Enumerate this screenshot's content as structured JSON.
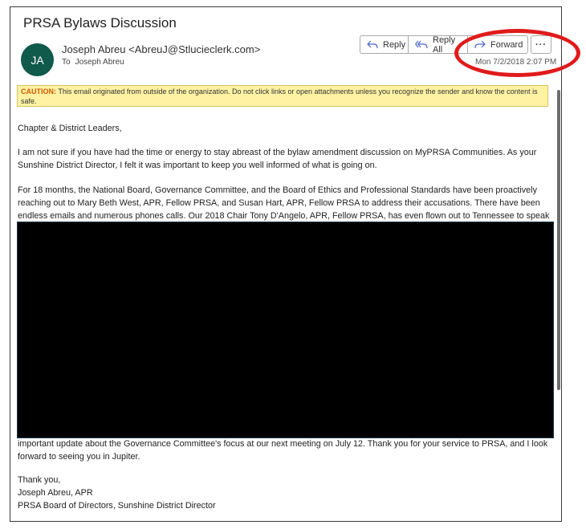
{
  "email": {
    "subject": "PRSA Bylaws Discussion",
    "avatar_initials": "JA",
    "sender": "Joseph Abreu <AbreuJ@Stlucieclerk.com>",
    "to_label": "To",
    "to_name": "Joseph Abreu",
    "date": "Mon 7/2/2018 2:07 PM"
  },
  "actions": {
    "reply": "Reply",
    "reply_all": "Reply All",
    "forward": "Forward",
    "more": "···"
  },
  "caution": {
    "label": "CAUTION:",
    "text": " This email originated from outside of the organization. Do not click links or open attachments unless you recognize the sender and know the content is safe."
  },
  "body": {
    "greeting": "Chapter & District Leaders,",
    "para1": "I am not sure if you have had the time or energy to stay abreast of the bylaw amendment discussion on MyPRSA Communities. As your Sunshine District Director, I felt it was important to keep you well informed of what is going on.",
    "para2": "For 18 months, the National Board, Governance Committee, and the Board of Ethics and Professional Standards have been proactively reaching out to Mary Beth West, APR, Fellow PRSA, and Susan Hart, APR, Fellow PRSA to address their accusations. There have been endless emails and numerous phones calls. Our 2018 Chair Tony D'Angelo, APR, Fellow PRSA, has even flown out to Tennessee to speak with them and provide",
    "para3": "important update about the Governance Committee's focus at our next meeting on July 12. Thank you for your service to PRSA, and I look forward to seeing you in Jupiter.",
    "closing": "Thank you,",
    "sig_name": "Joseph Abreu, APR",
    "sig_title": "PRSA Board of Directors, Sunshine District Director"
  },
  "colors": {
    "avatar": "#0f5a4a",
    "caution_bg": "#fff2a3",
    "caution_label": "#d05a00",
    "highlight_circle": "#e01b1b",
    "redaction": "#000000"
  }
}
